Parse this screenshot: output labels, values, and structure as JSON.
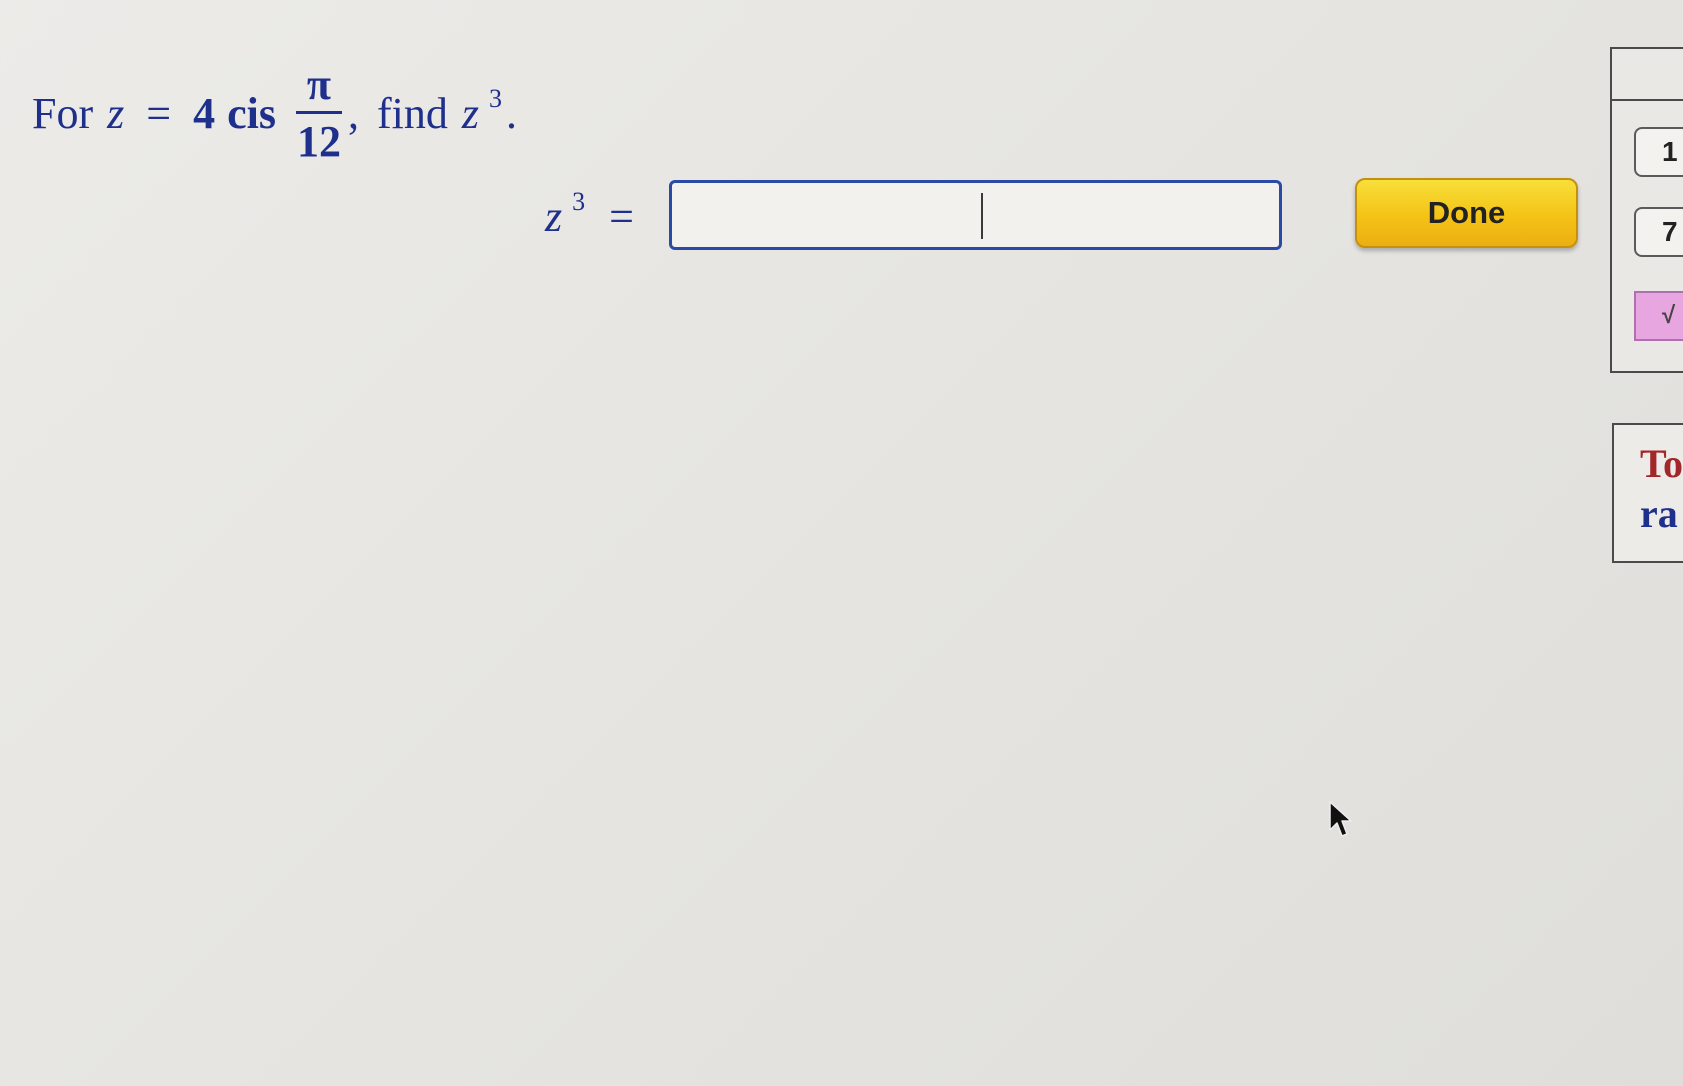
{
  "question": {
    "prefix": "For",
    "variable": "z",
    "equals": "=",
    "modulus": "4",
    "function": "cis",
    "fraction_numerator": "π",
    "fraction_denominator": "12",
    "separator": ",",
    "find_label": "find",
    "target_variable": "z",
    "target_exponent": "3",
    "end": "."
  },
  "answer": {
    "variable": "z",
    "exponent": "3",
    "equals": "=",
    "input_value": ""
  },
  "done_button": {
    "label": "Done",
    "color": "#f4c316"
  },
  "side_panel": {
    "keys": [
      "1",
      "7",
      "√"
    ]
  },
  "hint_box": {
    "line1": "To",
    "line2": "ra"
  },
  "colors": {
    "math_text": "#1f2f8c",
    "input_border": "#2a4aa6",
    "hint_accent": "#a3262b",
    "key_highlight": "#e8a6e0"
  },
  "icons": {
    "pointer": "arrow-cursor-icon"
  }
}
